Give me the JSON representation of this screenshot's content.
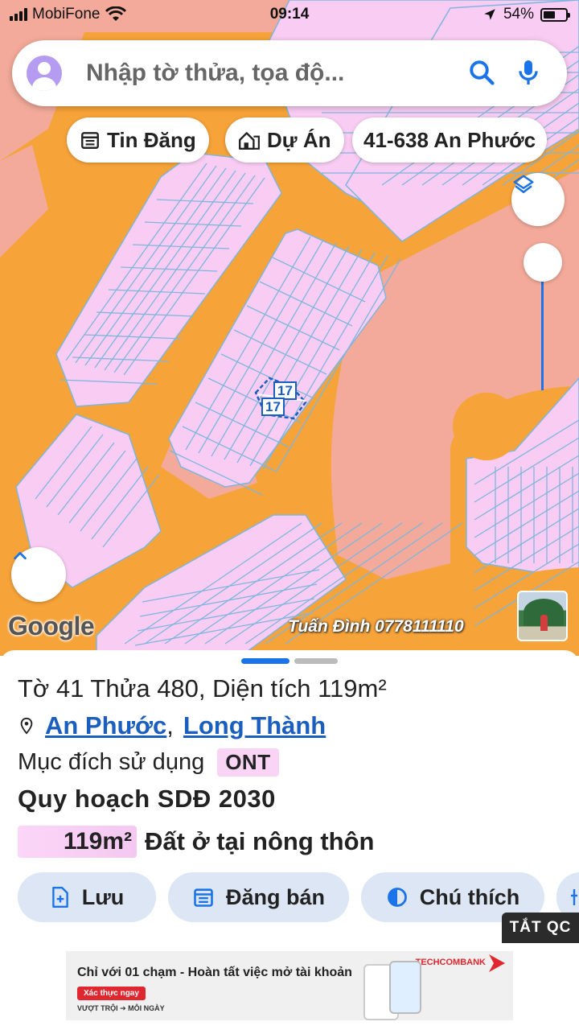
{
  "status_bar": {
    "carrier": "MobiFone",
    "time": "09:14",
    "battery": "54%"
  },
  "search": {
    "placeholder": "Nhập tờ thửa, tọa độ..."
  },
  "chips": [
    {
      "label": "Tin Đăng",
      "icon": "calendar-icon"
    },
    {
      "label": "Dự Án",
      "icon": "house-icon"
    },
    {
      "label": "41-638 An Phước"
    }
  ],
  "map": {
    "parcel_labels": [
      "17",
      "17"
    ],
    "logo": "Google",
    "watermark": "Tuấn Đình 0778111110",
    "colors": {
      "road": "#f6a33a",
      "residential": "#f9cdf3",
      "green_area": "#f3aa9a",
      "parcel_lines": "#7fb6dd",
      "selected_parcel": "#1a5fc0"
    }
  },
  "parcel": {
    "title": "Tờ 41 Thửa 480, Diện tích 119m²",
    "ward": "An Phước",
    "district": "Long Thành",
    "separator": ",",
    "purpose_label": "Mục đích sử dụng",
    "purpose_code": "ONT",
    "plan_title": "Quy hoạch SDĐ 2030",
    "plan_area": "119m²",
    "plan_type": "Đất ở tại nông thôn"
  },
  "actions": [
    {
      "label": "Lưu",
      "icon": "add-file-icon"
    },
    {
      "label": "Đăng bán",
      "icon": "calendar-icon"
    },
    {
      "label": "Chú thích",
      "icon": "contrast-icon"
    }
  ],
  "ad": {
    "close_label": "TẮT QC",
    "headline": "Chỉ với 01 chạm - Hoàn tất việc mở tài khoản",
    "cta": "Xác thực ngay",
    "tagline": "VƯỢT TRỘI ➔ MỖI NGÀY",
    "brand": "TECHCOMBANK"
  }
}
